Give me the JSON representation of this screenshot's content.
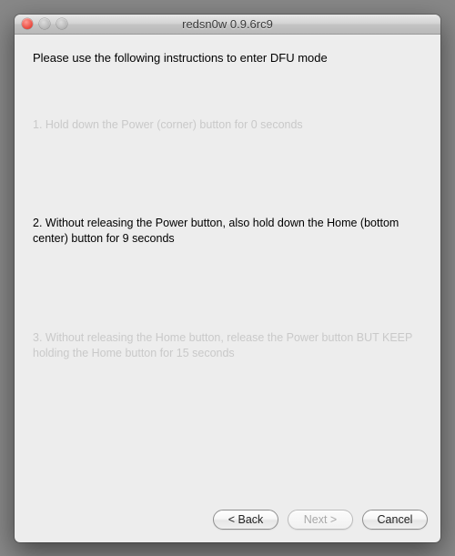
{
  "window": {
    "title": "redsn0w 0.9.6rc9"
  },
  "heading": "Please use the following instructions to enter DFU mode",
  "steps": {
    "s1": "1. Hold down the Power (corner) button for 0 seconds",
    "s2": "2. Without releasing the Power button, also hold down the Home (bottom center) button for 9 seconds",
    "s3": "3. Without releasing the Home button, release the Power button BUT KEEP holding the Home button for 15 seconds"
  },
  "buttons": {
    "back": "< Back",
    "next": "Next >",
    "cancel": "Cancel"
  }
}
